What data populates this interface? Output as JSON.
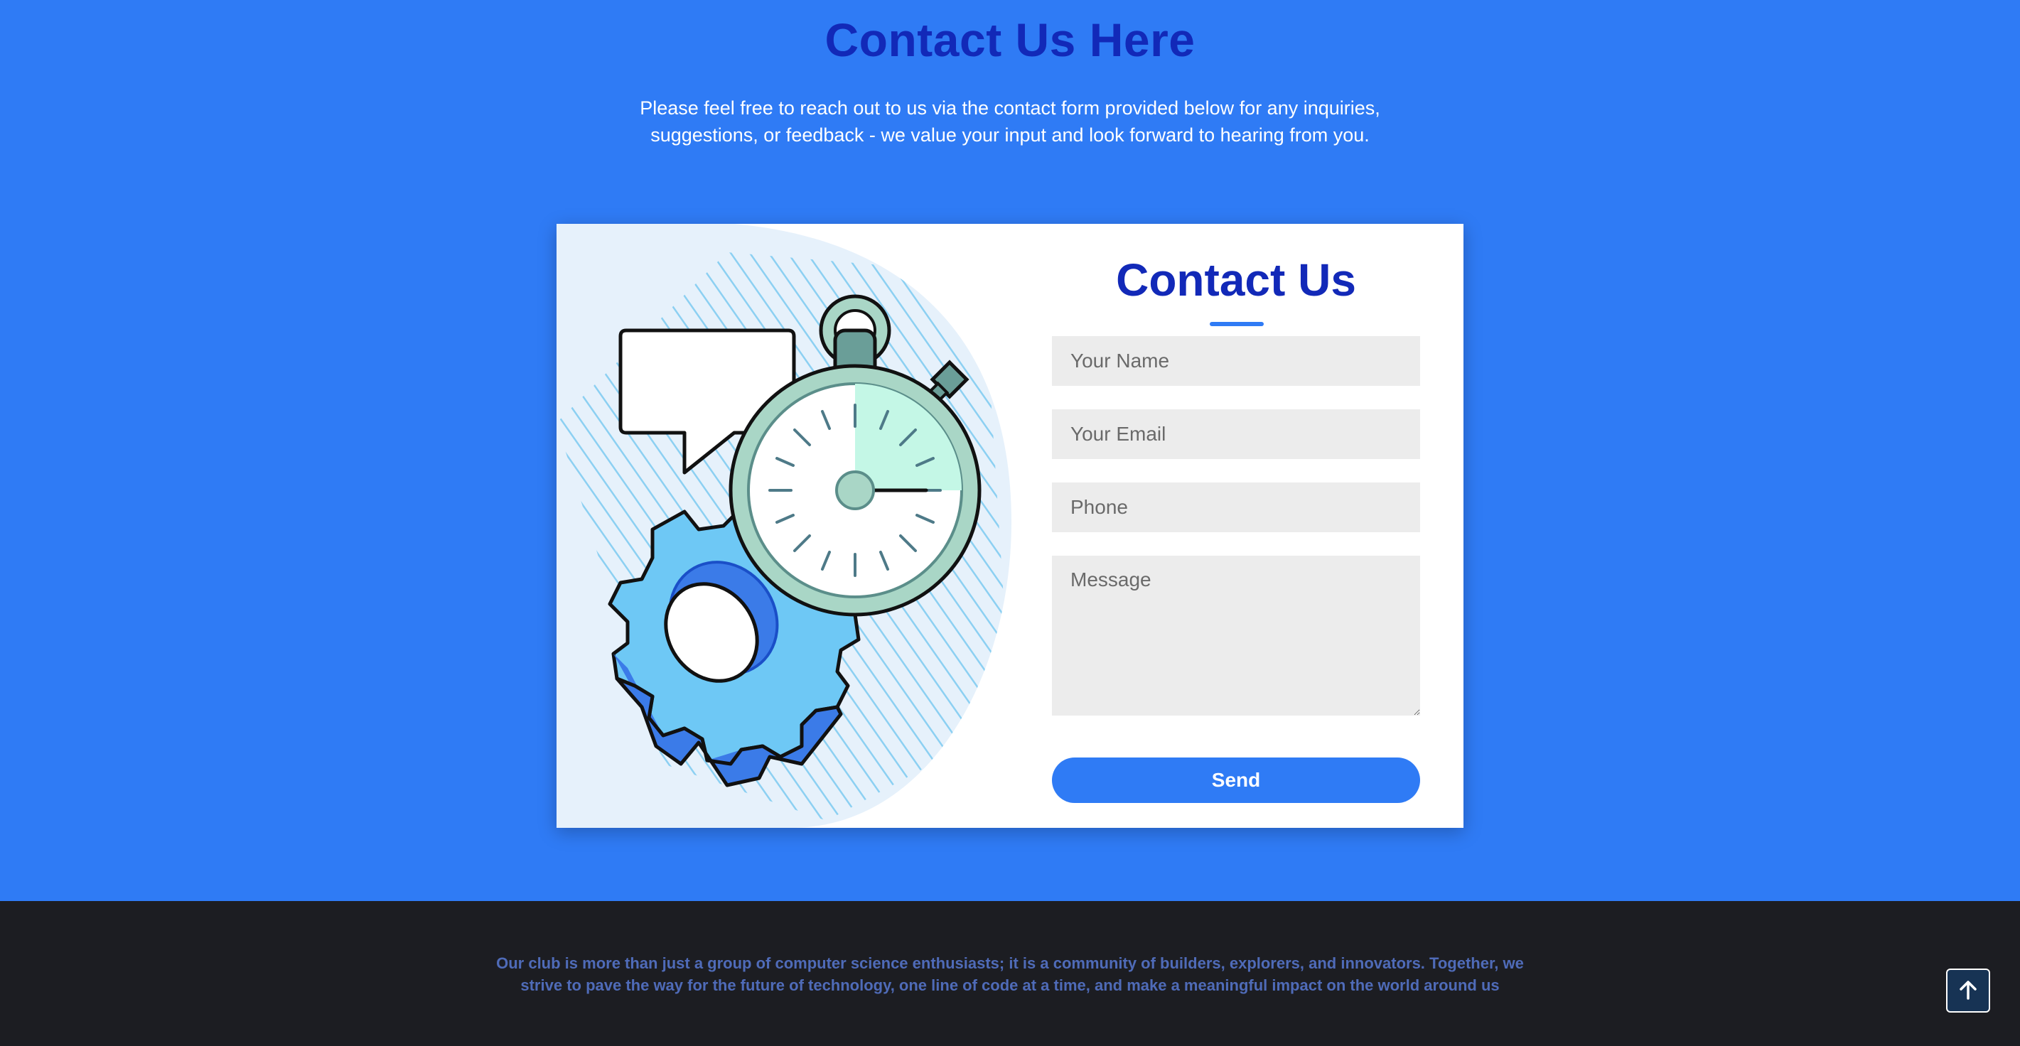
{
  "hero": {
    "title": "Contact Us Here",
    "description": "Please feel free to reach out to us via the contact form provided below for any inquiries, suggestions, or feedback - we value your input and look forward to hearing from you."
  },
  "contact_form": {
    "title": "Contact Us",
    "name_placeholder": "Your Name",
    "email_placeholder": "Your Email",
    "phone_placeholder": "Phone",
    "message_placeholder": "Message",
    "send_label": "Send"
  },
  "illustration": {
    "icons": [
      "speech-bubble-icon",
      "stopwatch-icon",
      "gear-icon"
    ]
  },
  "footer": {
    "text": "Our club is more than just a group of computer science enthusiasts; it is a community of builders, explorers, and innovators. Together, we strive to pave the way for the future of technology, one line of code at a time, and make a meaningful impact on the world around us"
  },
  "scroll_top": {
    "icon": "arrow-up-icon"
  },
  "colors": {
    "background": "#2f7bf5",
    "heading": "#1229b8",
    "footer_bg": "#1c1d22",
    "footer_text": "#4f6bb8",
    "field_bg": "#ececec"
  }
}
